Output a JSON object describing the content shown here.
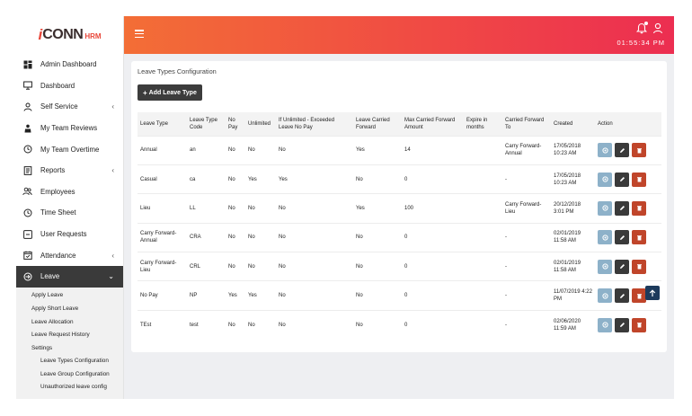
{
  "logo": {
    "i": "i",
    "conn": "CONN",
    "hrm": "HRM"
  },
  "header": {
    "clock": "01:55:34 PM"
  },
  "sidebar": {
    "items": [
      {
        "label": "Admin Dashboard",
        "icon": "grid-icon"
      },
      {
        "label": "Dashboard",
        "icon": "monitor-icon"
      },
      {
        "label": "Self Service",
        "icon": "user-icon",
        "chevron": "‹"
      },
      {
        "label": "My Team Reviews",
        "icon": "thumbs-up-icon"
      },
      {
        "label": "My Team Overtime",
        "icon": "history-icon"
      },
      {
        "label": "Reports",
        "icon": "report-icon",
        "chevron": "‹"
      },
      {
        "label": "Employees",
        "icon": "users-icon"
      },
      {
        "label": "Time Sheet",
        "icon": "clock-icon"
      },
      {
        "label": "User Requests",
        "icon": "request-icon"
      },
      {
        "label": "Attendance",
        "icon": "calendar-check-icon",
        "chevron": "‹"
      },
      {
        "label": "Leave",
        "icon": "sign-out-icon",
        "chevron": "⌄"
      }
    ],
    "submenu": [
      {
        "label": "Apply Leave"
      },
      {
        "label": "Apply Short Leave"
      },
      {
        "label": "Leave Allocation"
      },
      {
        "label": "Leave Request History"
      },
      {
        "label": "Settings"
      },
      {
        "label": "Leave Types Configuration"
      },
      {
        "label": "Leave Group Configuration"
      },
      {
        "label": "Unauthorized leave config"
      }
    ]
  },
  "main": {
    "title": "Leave Types Configuration",
    "add_button": "Add Leave Type",
    "columns": [
      "Leave Type",
      "Leave Type Code",
      "No Pay",
      "Unlimited",
      "If Unlimited - Exceeded Leave No Pay",
      "Leave Carried Forward",
      "Max Carried Forward Amount",
      "Expire in months",
      "Carried Forward To",
      "Created",
      "Action"
    ],
    "rows": [
      [
        "Annual",
        "an",
        "No",
        "No",
        "No",
        "Yes",
        "14",
        "",
        "Carry Forward-Annual",
        "17/05/2018 10:23 AM"
      ],
      [
        "Casual",
        "ca",
        "No",
        "Yes",
        "Yes",
        "No",
        "0",
        "",
        "-",
        "17/05/2018 10:23 AM"
      ],
      [
        "Lieu",
        "LL",
        "No",
        "No",
        "No",
        "Yes",
        "100",
        "",
        "Carry Forward-Lieu",
        "20/12/2018 3:01 PM"
      ],
      [
        "Carry Forward-Annual",
        "CRA",
        "No",
        "No",
        "No",
        "No",
        "0",
        "",
        "-",
        "02/01/2019 11:58 AM"
      ],
      [
        "Carry Forward-Lieu",
        "CRL",
        "No",
        "No",
        "No",
        "No",
        "0",
        "",
        "-",
        "02/01/2019 11:58 AM"
      ],
      [
        "No Pay",
        "NP",
        "Yes",
        "Yes",
        "No",
        "No",
        "0",
        "",
        "-",
        "11/07/2019 4:22 PM"
      ],
      [
        "TEst",
        "test",
        "No",
        "No",
        "No",
        "No",
        "0",
        "",
        "-",
        "02/06/2020 11:59 AM"
      ]
    ]
  },
  "colors": {
    "header_start": "#f36e36",
    "header_end": "#ec2e51",
    "view": "#8db1c9",
    "edit": "#3a3a3a",
    "delete": "#c0452a"
  }
}
